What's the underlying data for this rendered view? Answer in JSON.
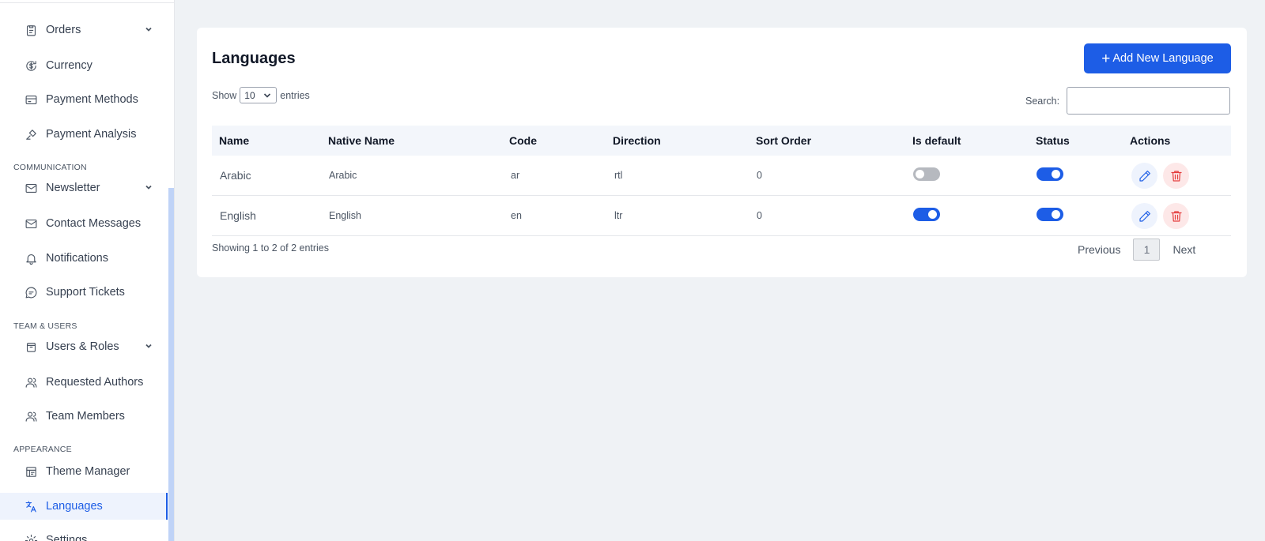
{
  "sidebar": {
    "items": [
      {
        "label": "Orders",
        "icon": "clipboard-icon",
        "has_chevron": true
      },
      {
        "label": "Currency",
        "icon": "currency-icon",
        "has_chevron": false
      },
      {
        "label": "Payment Methods",
        "icon": "credit-card-icon",
        "has_chevron": false
      },
      {
        "label": "Payment Analysis",
        "icon": "analysis-icon",
        "has_chevron": false
      },
      {
        "label": "Newsletter",
        "icon": "mail-icon",
        "has_chevron": true
      },
      {
        "label": "Contact Messages",
        "icon": "mail-icon",
        "has_chevron": false
      },
      {
        "label": "Notifications",
        "icon": "bell-icon",
        "has_chevron": false
      },
      {
        "label": "Support Tickets",
        "icon": "chat-icon",
        "has_chevron": false
      },
      {
        "label": "Users & Roles",
        "icon": "box-icon",
        "has_chevron": true
      },
      {
        "label": "Requested Authors",
        "icon": "users-icon",
        "has_chevron": false
      },
      {
        "label": "Team Members",
        "icon": "users-icon",
        "has_chevron": false
      },
      {
        "label": "Theme Manager",
        "icon": "theme-icon",
        "has_chevron": false
      },
      {
        "label": "Languages",
        "icon": "translate-icon",
        "has_chevron": false,
        "active": true
      },
      {
        "label": "Settings",
        "icon": "gear-icon",
        "has_chevron": false
      }
    ],
    "sections": {
      "communication": "COMMUNICATION",
      "team_users": "TEAM & USERS",
      "appearance": "APPEARANCE"
    }
  },
  "page": {
    "title": "Languages",
    "add_button": "Add New Language",
    "show_label": "Show",
    "entries_label": "entries",
    "page_size": "10",
    "search_label": "Search:",
    "search_value": "",
    "columns": [
      "Name",
      "Native Name",
      "Code",
      "Direction",
      "Sort Order",
      "Is default",
      "Status",
      "Actions"
    ],
    "rows": [
      {
        "name": "Arabic",
        "native_name": "Arabic",
        "code": "ar",
        "direction": "rtl",
        "sort_order": "0",
        "is_default": false,
        "status": true
      },
      {
        "name": "English",
        "native_name": "English",
        "code": "en",
        "direction": "ltr",
        "sort_order": "0",
        "is_default": true,
        "status": true
      }
    ],
    "info": "Showing 1 to 2 of 2 entries",
    "pagination": {
      "previous": "Previous",
      "current": "1",
      "next": "Next"
    }
  },
  "colors": {
    "primary": "#1d5de6",
    "danger": "#e53e3e",
    "background": "#eff2f5"
  }
}
